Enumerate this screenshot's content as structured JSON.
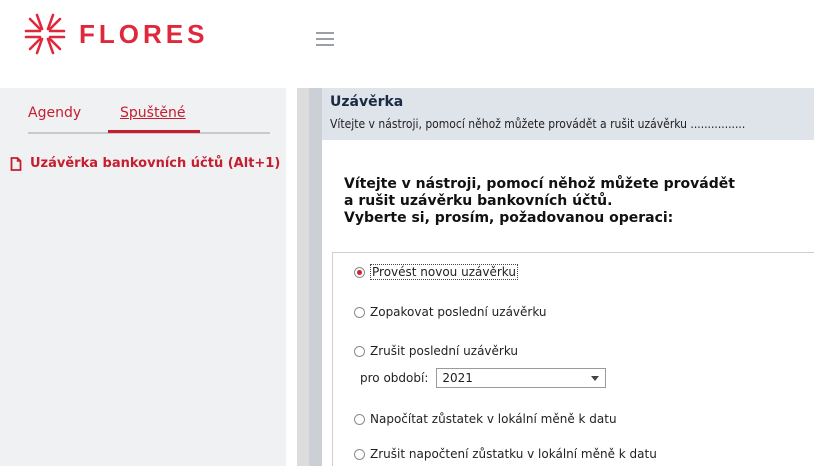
{
  "app": {
    "logo_text": "FLORES",
    "brand_color": "#e0283c"
  },
  "sidebar": {
    "tabs": [
      {
        "label": "Agendy"
      },
      {
        "label": "Spuštěné",
        "active": true
      }
    ],
    "running_items": [
      {
        "label": "Uzávěrka bankovních účtů (Alt+1)",
        "icon": "document-icon"
      }
    ]
  },
  "main": {
    "title": "Uzávěrka",
    "subtitle": "Vítejte v nástroji, pomocí něhož můžete provádět a rušit uzávěrku ................",
    "welcome_lines": [
      "Vítejte v nástroji, pomocí něhož můžete provádět",
      "a rušit uzávěrku bankovních účtů.",
      "Vyberte si, prosím, požadovanou operaci:"
    ],
    "options": [
      {
        "label": "Provést novou uzávěrku",
        "checked": true
      },
      {
        "label": "Zopakovat poslední uzávěrku",
        "checked": false
      },
      {
        "label": "Zrušit poslední uzávěrku",
        "checked": false
      },
      {
        "label": "Napočítat zůstatek v lokální měně k datu",
        "checked": false
      },
      {
        "label": "Zrušit napočtení zůstatku v lokální měně k datu",
        "checked": false
      }
    ],
    "period": {
      "label": "pro období:",
      "value": "2021"
    }
  }
}
